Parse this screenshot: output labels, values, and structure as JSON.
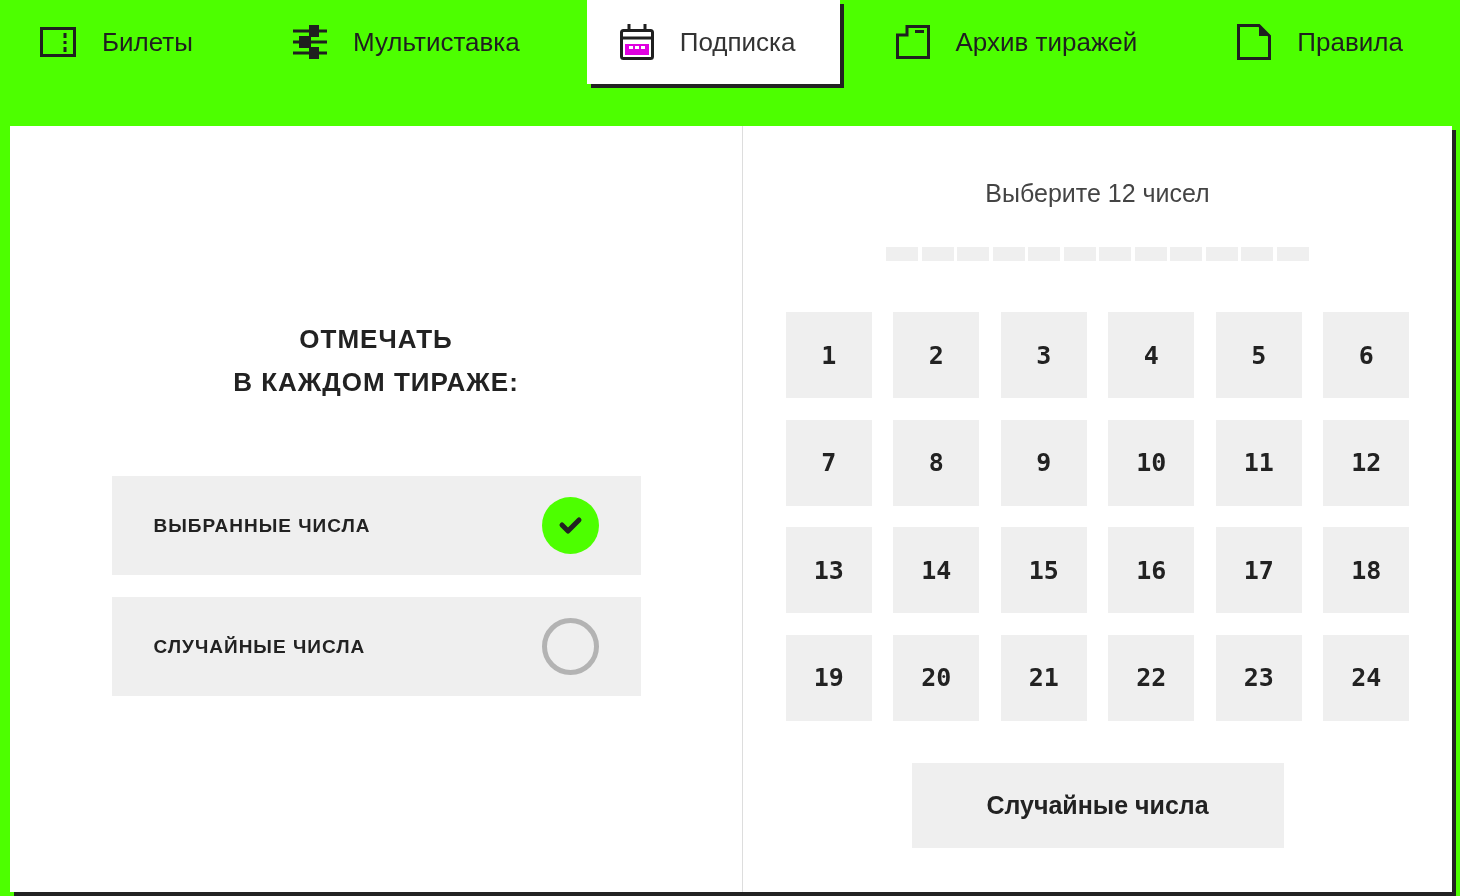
{
  "tabs": [
    {
      "label": "Билеты",
      "selected": false
    },
    {
      "label": "Мультиставка",
      "selected": false
    },
    {
      "label": "Подписка",
      "selected": true
    },
    {
      "label": "Архив тиражей",
      "selected": false
    },
    {
      "label": "Правила",
      "selected": false
    }
  ],
  "mark_panel": {
    "heading": "ОТМЕЧАТЬ\nВ КАЖДОМ ТИРАЖЕ:",
    "options": [
      {
        "label": "ВЫБРАННЫЕ ЧИСЛА",
        "selected": true
      },
      {
        "label": "СЛУЧАЙНЫЕ ЧИСЛА",
        "selected": false
      }
    ]
  },
  "number_picker": {
    "prompt": "Выберите 12 чисел",
    "slots": [
      {
        "filled": false
      },
      {
        "filled": false
      },
      {
        "filled": false
      },
      {
        "filled": false
      },
      {
        "filled": false
      },
      {
        "filled": false
      },
      {
        "filled": false
      },
      {
        "filled": false
      },
      {
        "filled": false
      },
      {
        "filled": false
      },
      {
        "filled": false
      },
      {
        "filled": false
      }
    ],
    "numbers": [
      {
        "label": "1",
        "selected": false
      },
      {
        "label": "2",
        "selected": false
      },
      {
        "label": "3",
        "selected": false
      },
      {
        "label": "4",
        "selected": false
      },
      {
        "label": "5",
        "selected": false
      },
      {
        "label": "6",
        "selected": false
      },
      {
        "label": "7",
        "selected": false
      },
      {
        "label": "8",
        "selected": false
      },
      {
        "label": "9",
        "selected": false
      },
      {
        "label": "10",
        "selected": false
      },
      {
        "label": "11",
        "selected": false
      },
      {
        "label": "12",
        "selected": false
      },
      {
        "label": "13",
        "selected": false
      },
      {
        "label": "14",
        "selected": false
      },
      {
        "label": "15",
        "selected": false
      },
      {
        "label": "16",
        "selected": false
      },
      {
        "label": "17",
        "selected": false
      },
      {
        "label": "18",
        "selected": false
      },
      {
        "label": "19",
        "selected": false
      },
      {
        "label": "20",
        "selected": false
      },
      {
        "label": "21",
        "selected": false
      },
      {
        "label": "22",
        "selected": false
      },
      {
        "label": "23",
        "selected": false
      },
      {
        "label": "24",
        "selected": false
      }
    ],
    "random_button": "Случайные числа"
  }
}
